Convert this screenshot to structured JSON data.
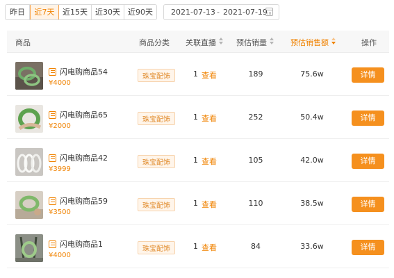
{
  "toolbar": {
    "ranges": [
      "昨日",
      "近7天",
      "近15天",
      "近30天",
      "近90天"
    ],
    "active_range": "近7天",
    "date_start": "2021-07-13",
    "date_sep": "-",
    "date_end": "2021-07-19"
  },
  "table": {
    "headers": {
      "product": "商品",
      "category": "商品分类",
      "live": "关联直播",
      "sales": "预估销量",
      "gmv": "预估销售额",
      "action": "操作"
    },
    "rows": [
      {
        "name": "闪电购商品54",
        "price": "¥4000",
        "category": "珠宝配饰",
        "live_count": "1",
        "live_link": "查看",
        "sales": "189",
        "gmv": "75.6w",
        "action": "详情"
      },
      {
        "name": "闪电购商品65",
        "price": "¥2000",
        "category": "珠宝配饰",
        "live_count": "1",
        "live_link": "查看",
        "sales": "252",
        "gmv": "50.4w",
        "action": "详情"
      },
      {
        "name": "闪电购商品42",
        "price": "¥3999",
        "category": "珠宝配饰",
        "live_count": "1",
        "live_link": "查看",
        "sales": "105",
        "gmv": "42.0w",
        "action": "详情"
      },
      {
        "name": "闪电购商品59",
        "price": "¥3500",
        "category": "珠宝配饰",
        "live_count": "1",
        "live_link": "查看",
        "sales": "110",
        "gmv": "38.5w",
        "action": "详情"
      },
      {
        "name": "闪电购商品1",
        "price": "¥4000",
        "category": "珠宝配饰",
        "live_count": "1",
        "live_link": "查看",
        "sales": "84",
        "gmv": "33.6w",
        "action": "详情"
      }
    ]
  },
  "colors": {
    "accent": "#f08200",
    "button": "#f5901e",
    "tag_bg": "#fff5ea",
    "header_bg": "#f7f7f7"
  }
}
